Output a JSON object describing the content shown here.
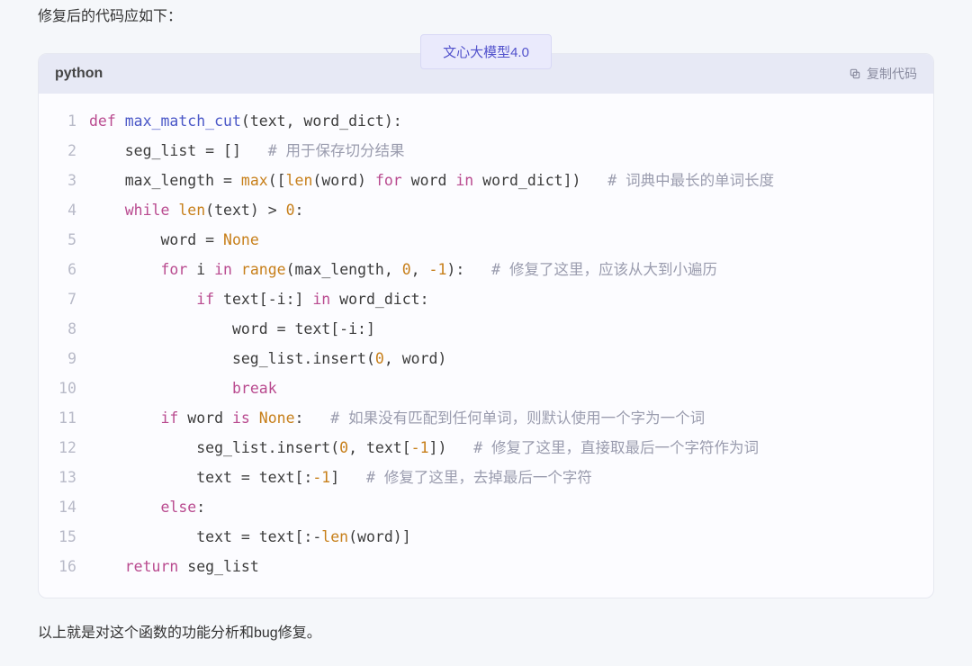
{
  "intro": "修复后的代码应如下：",
  "badge": "文心大模型4.0",
  "code_header": {
    "language": "python",
    "copy_label": "复制代码"
  },
  "outro": "以上就是对这个函数的功能分析和bug修复。",
  "code": {
    "line_count": 16,
    "lines": [
      [
        {
          "c": "kw",
          "t": "def"
        },
        {
          "c": "txt",
          "t": " "
        },
        {
          "c": "fn",
          "t": "max_match_cut"
        },
        {
          "c": "txt",
          "t": "(text, word_dict):"
        }
      ],
      [
        {
          "c": "txt",
          "t": "    seg_list = []   "
        },
        {
          "c": "cm",
          "t": "# 用于保存切分结果"
        }
      ],
      [
        {
          "c": "txt",
          "t": "    max_length = "
        },
        {
          "c": "bi",
          "t": "max"
        },
        {
          "c": "txt",
          "t": "(["
        },
        {
          "c": "bi",
          "t": "len"
        },
        {
          "c": "txt",
          "t": "(word) "
        },
        {
          "c": "kw",
          "t": "for"
        },
        {
          "c": "txt",
          "t": " word "
        },
        {
          "c": "kw",
          "t": "in"
        },
        {
          "c": "txt",
          "t": " word_dict])   "
        },
        {
          "c": "cm",
          "t": "# 词典中最长的单词长度"
        }
      ],
      [
        {
          "c": "txt",
          "t": "    "
        },
        {
          "c": "kw",
          "t": "while"
        },
        {
          "c": "txt",
          "t": " "
        },
        {
          "c": "bi",
          "t": "len"
        },
        {
          "c": "txt",
          "t": "(text) > "
        },
        {
          "c": "num",
          "t": "0"
        },
        {
          "c": "txt",
          "t": ":"
        }
      ],
      [
        {
          "c": "txt",
          "t": "        word = "
        },
        {
          "c": "bi",
          "t": "None"
        }
      ],
      [
        {
          "c": "txt",
          "t": "        "
        },
        {
          "c": "kw",
          "t": "for"
        },
        {
          "c": "txt",
          "t": " i "
        },
        {
          "c": "kw",
          "t": "in"
        },
        {
          "c": "txt",
          "t": " "
        },
        {
          "c": "bi",
          "t": "range"
        },
        {
          "c": "txt",
          "t": "(max_length, "
        },
        {
          "c": "num",
          "t": "0"
        },
        {
          "c": "txt",
          "t": ", "
        },
        {
          "c": "num",
          "t": "-1"
        },
        {
          "c": "txt",
          "t": "):   "
        },
        {
          "c": "cm",
          "t": "# 修复了这里，应该从大到小遍历"
        }
      ],
      [
        {
          "c": "txt",
          "t": "            "
        },
        {
          "c": "kw",
          "t": "if"
        },
        {
          "c": "txt",
          "t": " text[-i:] "
        },
        {
          "c": "kw",
          "t": "in"
        },
        {
          "c": "txt",
          "t": " word_dict:"
        }
      ],
      [
        {
          "c": "txt",
          "t": "                word = text[-i:]"
        }
      ],
      [
        {
          "c": "txt",
          "t": "                seg_list.insert("
        },
        {
          "c": "num",
          "t": "0"
        },
        {
          "c": "txt",
          "t": ", word)"
        }
      ],
      [
        {
          "c": "txt",
          "t": "                "
        },
        {
          "c": "kw",
          "t": "break"
        }
      ],
      [
        {
          "c": "txt",
          "t": "        "
        },
        {
          "c": "kw",
          "t": "if"
        },
        {
          "c": "txt",
          "t": " word "
        },
        {
          "c": "kw",
          "t": "is"
        },
        {
          "c": "txt",
          "t": " "
        },
        {
          "c": "bi",
          "t": "None"
        },
        {
          "c": "txt",
          "t": ":   "
        },
        {
          "c": "cm",
          "t": "# 如果没有匹配到任何单词，则默认使用一个字为一个词"
        }
      ],
      [
        {
          "c": "txt",
          "t": "            seg_list.insert("
        },
        {
          "c": "num",
          "t": "0"
        },
        {
          "c": "txt",
          "t": ", text["
        },
        {
          "c": "num",
          "t": "-1"
        },
        {
          "c": "txt",
          "t": "])   "
        },
        {
          "c": "cm",
          "t": "# 修复了这里，直接取最后一个字符作为词"
        }
      ],
      [
        {
          "c": "txt",
          "t": "            text = text[:"
        },
        {
          "c": "num",
          "t": "-1"
        },
        {
          "c": "txt",
          "t": "]   "
        },
        {
          "c": "cm",
          "t": "# 修复了这里，去掉最后一个字符"
        }
      ],
      [
        {
          "c": "txt",
          "t": "        "
        },
        {
          "c": "kw",
          "t": "else"
        },
        {
          "c": "txt",
          "t": ":"
        }
      ],
      [
        {
          "c": "txt",
          "t": "            text = text[:-"
        },
        {
          "c": "bi",
          "t": "len"
        },
        {
          "c": "txt",
          "t": "(word)]"
        }
      ],
      [
        {
          "c": "txt",
          "t": "    "
        },
        {
          "c": "kw",
          "t": "return"
        },
        {
          "c": "txt",
          "t": " seg_list"
        }
      ]
    ]
  }
}
